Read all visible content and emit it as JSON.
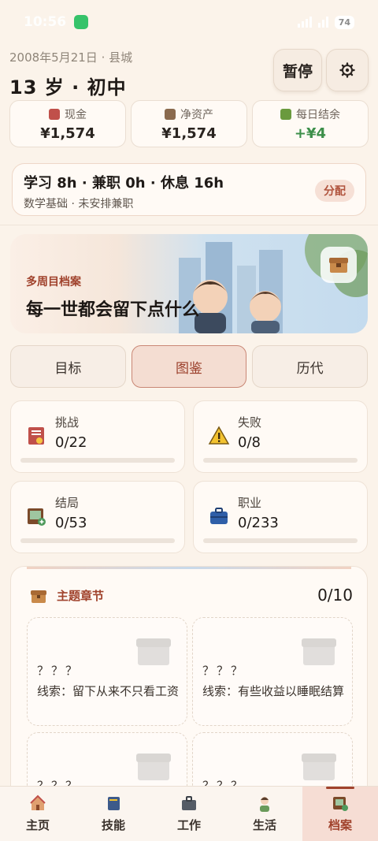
{
  "status_bar": {
    "time": "10:56",
    "battery": "74"
  },
  "header": {
    "date_location": "2008年5月21日 · 县城",
    "age_stage": "13 岁 · 初中",
    "pause_label": "暂停",
    "settings_icon": "gear-icon"
  },
  "stats": [
    {
      "label": "现金",
      "value": "¥1,574",
      "icon": "money-icon"
    },
    {
      "label": "净资产",
      "value": "¥1,574",
      "icon": "bank-icon"
    },
    {
      "label": "每日结余",
      "value": "+¥4",
      "icon": "sprout-icon"
    }
  ],
  "schedule": {
    "summary": "学习 8h · 兼职 0h · 休息 16h",
    "detail": "数学基础 · 未安排兼职",
    "assign_label": "分配"
  },
  "banner": {
    "kicker": "多周目档案",
    "title": "每一世都会留下点什么"
  },
  "tabs": [
    {
      "label": "目标",
      "active": false
    },
    {
      "label": "图鉴",
      "active": true
    },
    {
      "label": "历代",
      "active": false
    }
  ],
  "collections": [
    {
      "label": "挑战",
      "value": "0/22",
      "icon": "notebook-icon",
      "progress": 0
    },
    {
      "label": "失败",
      "value": "0/8",
      "icon": "warning-icon",
      "progress": 0
    },
    {
      "label": "结局",
      "value": "0/53",
      "icon": "photo-album-icon",
      "progress": 0
    },
    {
      "label": "职业",
      "value": "0/233",
      "icon": "briefcase-icon",
      "progress": 0
    }
  ],
  "chapters": {
    "title": "主题章节",
    "count": "0/10",
    "cards": [
      {
        "name": "？？？",
        "hint": "线索：留下从来不只看工资"
      },
      {
        "name": "？？？",
        "hint": "线索：有些收益以睡眠结算"
      },
      {
        "name": "？？？",
        "hint": ""
      },
      {
        "name": "？？？",
        "hint": ""
      }
    ]
  },
  "nav": [
    {
      "label": "主页",
      "icon": "house-icon",
      "active": false
    },
    {
      "label": "技能",
      "icon": "book-icon",
      "active": false
    },
    {
      "label": "工作",
      "icon": "briefcase-icon",
      "active": false
    },
    {
      "label": "生活",
      "icon": "person-icon",
      "active": false
    },
    {
      "label": "档案",
      "icon": "archive-icon",
      "active": true
    }
  ]
}
